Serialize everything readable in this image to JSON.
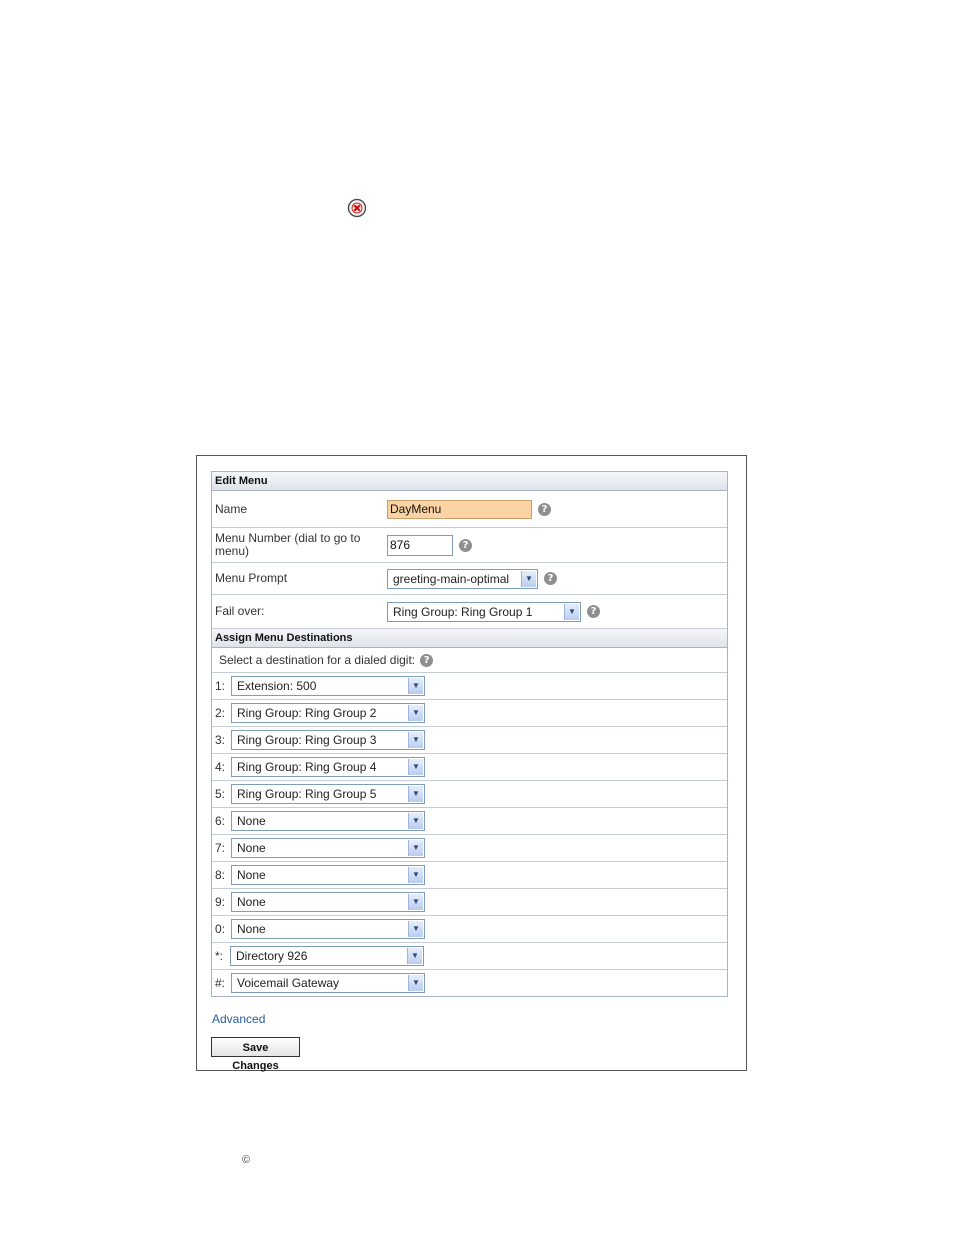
{
  "page": {
    "delete_icon": "delete-circle-icon",
    "copyright_symbol": "©"
  },
  "edit_menu": {
    "header": "Edit Menu",
    "name_label": "Name",
    "name_value": "DayMenu",
    "menu_number_label": "Menu Number (dial to go to menu)",
    "menu_number_value": "876",
    "menu_prompt_label": "Menu Prompt",
    "menu_prompt_value": "greeting-main-optimal",
    "fail_over_label": "Fail over:",
    "fail_over_value": "Ring Group: Ring Group 1",
    "help_icon": "question-icon",
    "name_highlight_color": "#fcd3a2"
  },
  "assign": {
    "header": "Assign Menu Destinations",
    "intro": "Select a destination for a dialed digit:",
    "rows": [
      {
        "digit": "1:",
        "value": "Extension: 500"
      },
      {
        "digit": "2:",
        "value": "Ring Group: Ring Group 2"
      },
      {
        "digit": "3:",
        "value": "Ring Group: Ring Group 3"
      },
      {
        "digit": "4:",
        "value": "Ring Group: Ring Group 4"
      },
      {
        "digit": "5:",
        "value": "Ring Group: Ring Group 5"
      },
      {
        "digit": "6:",
        "value": "None"
      },
      {
        "digit": "7:",
        "value": "None"
      },
      {
        "digit": "8:",
        "value": "None"
      },
      {
        "digit": "9:",
        "value": "None"
      },
      {
        "digit": "0:",
        "value": "None"
      },
      {
        "digit": "*:",
        "value": "Directory 926"
      },
      {
        "digit": "#:",
        "value": "Voicemail Gateway"
      }
    ]
  },
  "actions": {
    "advanced_link": "Advanced",
    "save_label": "Save Changes"
  }
}
